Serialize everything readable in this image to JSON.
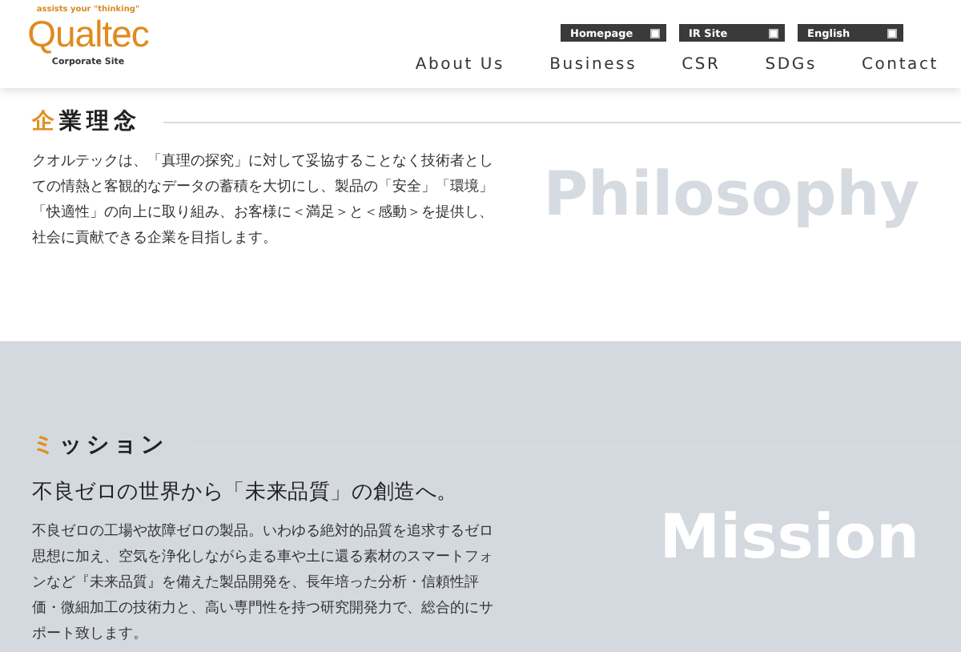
{
  "header": {
    "logo": {
      "tagline": "assists your \"thinking\"",
      "name": "Qualtec",
      "subtitle": "Corporate Site"
    },
    "top_links": [
      "Homepage",
      "IR Site",
      "English"
    ],
    "nav": [
      "About Us",
      "Business",
      "CSR",
      "SDGs",
      "Contact"
    ]
  },
  "sections": [
    {
      "kind": "white",
      "title": "企業理念",
      "body": "クオルテックは、「真理の探究」に対して妥協することなく技術者としての情熱と客観的なデータの蓄積を大切にし、製品の「安全」「環境」「快適性」の向上に取り組み、お客様に＜満足＞と＜感動＞を提供し、社会に貢献できる企業を目指します。",
      "watermark": "Philosophy"
    },
    {
      "kind": "gray",
      "title": "ミッション",
      "lead": "不良ゼロの世界から「未来品質」の創造へ。",
      "body": "不良ゼロの工場や故障ゼロの製品。いわゆる絶対的品質を追求するゼロ思想に加え、空気を浄化しながら走る車や土に還る素材のスマートフォンなど『未来品質』を備えた製品開発を、長年培った分析・信頼性評価・微細加工の技術力と、高い専門性を持つ研究開発力で、総合的にサポート致します。",
      "watermark": "Mission"
    }
  ]
}
